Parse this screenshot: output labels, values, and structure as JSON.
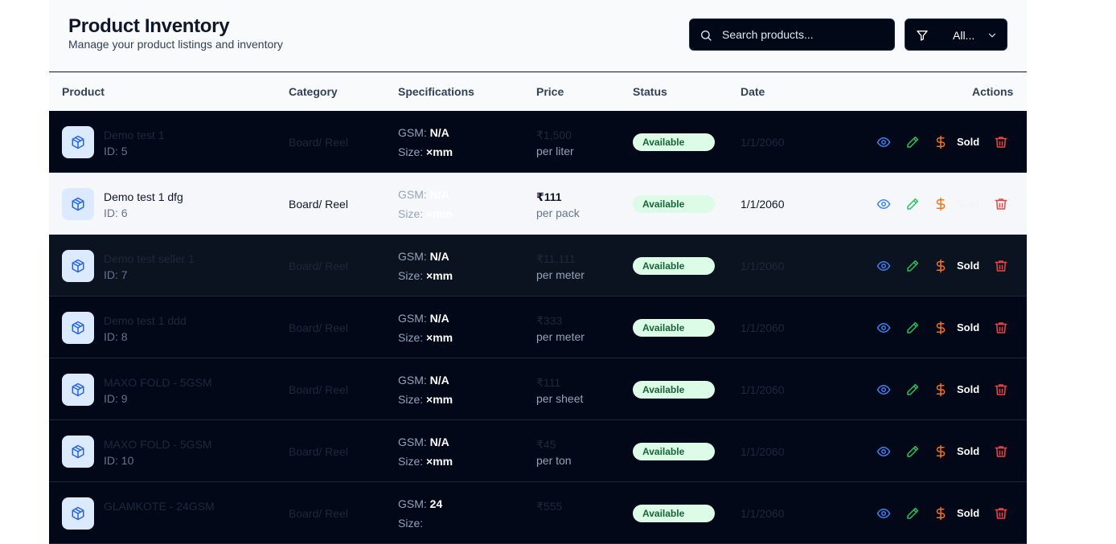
{
  "header": {
    "title": "Product Inventory",
    "subtitle": "Manage your product listings and inventory",
    "search_placeholder": "Search products...",
    "filter_label": "All..."
  },
  "columns": {
    "product": "Product",
    "category": "Category",
    "specifications": "Specifications",
    "price": "Price",
    "status": "Status",
    "date": "Date",
    "actions": "Actions"
  },
  "labels": {
    "gsm": "GSM:",
    "size": "Size:",
    "sold": "Sold"
  },
  "colors": {
    "view_icon": "#3b82f6",
    "edit_icon": "#22c55e",
    "price_icon": "#f97316",
    "delete_icon": "#ef4444"
  },
  "rows": [
    {
      "name": "Demo test 1",
      "id": "ID: 5",
      "category": "Board/ Reel",
      "gsm": "N/A",
      "size": "×mm",
      "price": "₹1,500",
      "unit": "per liter",
      "status": "Available",
      "date": "1/1/2060"
    },
    {
      "name": "Demo test 1 dfg",
      "id": "ID: 6",
      "category": "Board/ Reel",
      "gsm": "N/A",
      "size": "×mm",
      "price": "₹111",
      "unit": "per pack",
      "status": "Available",
      "date": "1/1/2060"
    },
    {
      "name": "Demo test seller 1",
      "id": "ID: 7",
      "category": "Board/ Reel",
      "gsm": "N/A",
      "size": "×mm",
      "price": "₹11,111",
      "unit": "per meter",
      "status": "Available",
      "date": "1/1/2060"
    },
    {
      "name": "Demo test 1 ddd",
      "id": "ID: 8",
      "category": "Board/ Reel",
      "gsm": "N/A",
      "size": "×mm",
      "price": "₹333",
      "unit": "per meter",
      "status": "Available",
      "date": "1/1/2060"
    },
    {
      "name": "MAXO FOLD - 5GSM",
      "id": "ID: 9",
      "category": "Board/ Reel",
      "gsm": "N/A",
      "size": "×mm",
      "price": "₹111",
      "unit": "per sheet",
      "status": "Available",
      "date": "1/1/2060"
    },
    {
      "name": "MAXO FOLD - 5GSM",
      "id": "ID: 10",
      "category": "Board/ Reel",
      "gsm": "N/A",
      "size": "×mm",
      "price": "₹45",
      "unit": "per ton",
      "status": "Available",
      "date": "1/1/2060"
    },
    {
      "name": "GLAMKOTE - 24GSM",
      "id": "",
      "category": "Board/ Reel",
      "gsm": "24",
      "size": "",
      "price": "₹555",
      "unit": "",
      "status": "Available",
      "date": "1/1/2060"
    }
  ]
}
